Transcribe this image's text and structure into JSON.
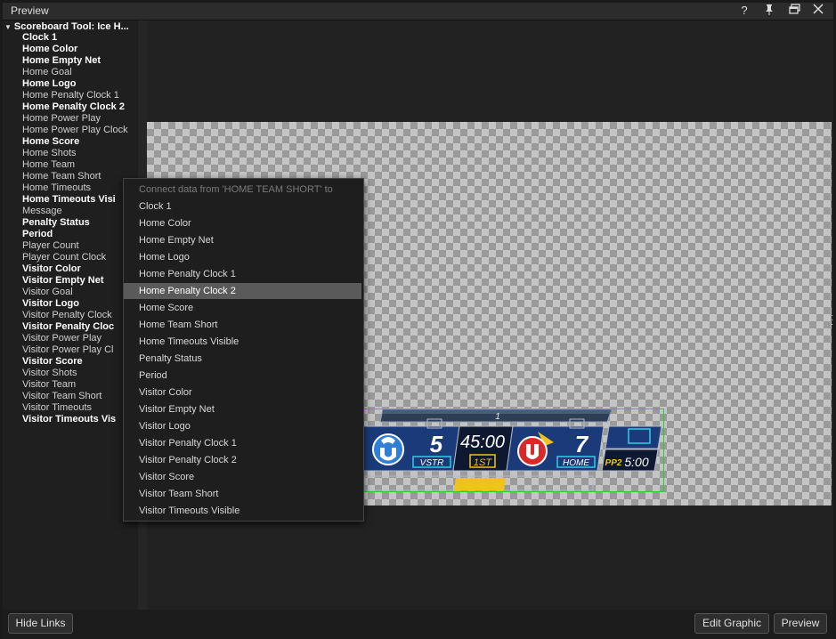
{
  "window": {
    "title": "Preview"
  },
  "tree": {
    "root": "Scoreboard Tool: Ice H...",
    "items": [
      {
        "label": "Clock 1",
        "bold": true
      },
      {
        "label": "Home Color",
        "bold": true
      },
      {
        "label": "Home Empty Net",
        "bold": true
      },
      {
        "label": "Home Goal",
        "bold": false
      },
      {
        "label": "Home Logo",
        "bold": true
      },
      {
        "label": "Home Penalty Clock 1",
        "bold": false
      },
      {
        "label": "Home Penalty Clock 2",
        "bold": true
      },
      {
        "label": "Home Power Play",
        "bold": false
      },
      {
        "label": "Home Power Play Clock",
        "bold": false
      },
      {
        "label": "Home Score",
        "bold": true
      },
      {
        "label": "Home Shots",
        "bold": false
      },
      {
        "label": "Home Team",
        "bold": false
      },
      {
        "label": "Home Team Short",
        "bold": false
      },
      {
        "label": "Home Timeouts",
        "bold": false
      },
      {
        "label": "Home Timeouts Visi",
        "bold": true
      },
      {
        "label": "Message",
        "bold": false
      },
      {
        "label": "Penalty Status",
        "bold": true
      },
      {
        "label": "Period",
        "bold": true
      },
      {
        "label": "Player Count",
        "bold": false
      },
      {
        "label": "Player Count Clock",
        "bold": false
      },
      {
        "label": "Visitor Color",
        "bold": true
      },
      {
        "label": "Visitor Empty Net",
        "bold": true
      },
      {
        "label": "Visitor Goal",
        "bold": false
      },
      {
        "label": "Visitor Logo",
        "bold": true
      },
      {
        "label": "Visitor Penalty Clock",
        "bold": false
      },
      {
        "label": "Visitor Penalty Cloc",
        "bold": true
      },
      {
        "label": "Visitor Power Play",
        "bold": false
      },
      {
        "label": "Visitor Power Play Cl",
        "bold": false
      },
      {
        "label": "Visitor Score",
        "bold": true
      },
      {
        "label": "Visitor Shots",
        "bold": false
      },
      {
        "label": "Visitor Team",
        "bold": false
      },
      {
        "label": "Visitor Team Short",
        "bold": false
      },
      {
        "label": "Visitor Timeouts",
        "bold": false
      },
      {
        "label": "Visitor Timeouts Vis",
        "bold": true
      }
    ]
  },
  "context_menu": {
    "header": "Connect data from 'HOME TEAM SHORT' to",
    "selected_index": 5,
    "items": [
      "Clock 1",
      "Home Color",
      "Home Empty Net",
      "Home Logo",
      "Home Penalty Clock 1",
      "Home Penalty Clock 2",
      "Home Score",
      "Home Team Short",
      "Home Timeouts Visible",
      "Penalty Status",
      "Period",
      "Visitor Color",
      "Visitor Empty Net",
      "Visitor Logo",
      "Visitor Penalty Clock 1",
      "Visitor Penalty Clock 2",
      "Visitor Score",
      "Visitor Team Short",
      "Visitor Timeouts Visible"
    ]
  },
  "scoreboard": {
    "period_bar": "1",
    "visitor_score": "5",
    "visitor_label": "VSTR",
    "clock": "45:00",
    "period": "1ST",
    "home_score": "7",
    "home_label": "HOME",
    "pp_label": "PP2",
    "pp_clock": "5:00"
  },
  "buttons": {
    "hide_links": "Hide Links",
    "edit_graphic": "Edit Graphic",
    "preview": "Preview"
  },
  "icons": {
    "help": "help-icon",
    "pin": "pin-icon",
    "restore": "restore-window-icon",
    "close": "close-icon"
  }
}
